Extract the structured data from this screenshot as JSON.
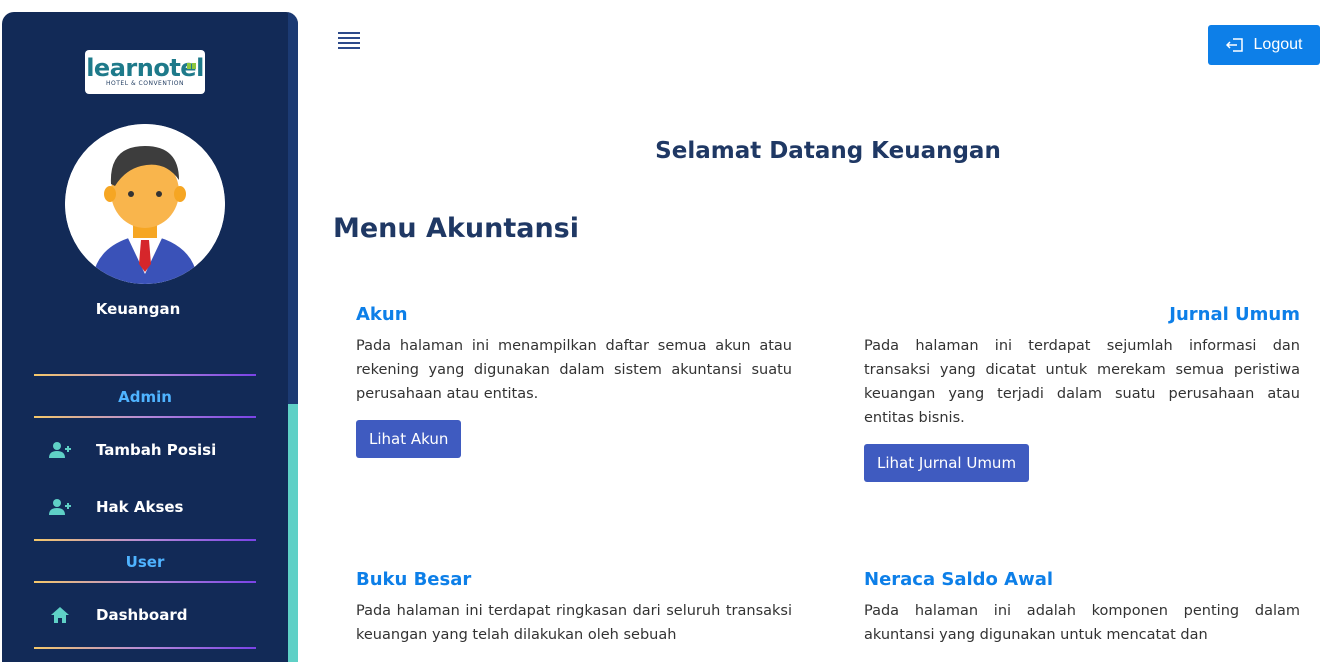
{
  "sidebar": {
    "logo": {
      "word": "learnotel",
      "subtitle": "HOTEL & CONVENTION"
    },
    "user_name": "Keuangan",
    "sections": [
      {
        "label": "Admin"
      },
      {
        "label": "User"
      }
    ],
    "items": [
      {
        "label": "Tambah Posisi",
        "icon": "user-plus-icon"
      },
      {
        "label": "Hak Akses",
        "icon": "user-plus-icon"
      },
      {
        "label": "Dashboard",
        "icon": "home-icon"
      }
    ]
  },
  "header": {
    "menu_icon": "hamburger-icon",
    "logout_label": "Logout"
  },
  "main": {
    "welcome": "Selamat Datang Keuangan",
    "title": "Menu Akuntansi",
    "cards": [
      {
        "title": "Akun",
        "desc": "Pada halaman ini menampilkan daftar semua akun atau rekening yang digunakan dalam sistem akuntansi suatu perusahaan atau entitas.",
        "button": "Lihat Akun"
      },
      {
        "title": "Jurnal Umum",
        "desc": "Pada halaman ini terdapat sejumlah informasi dan transaksi yang dicatat untuk merekam semua peristiwa keuangan yang terjadi dalam suatu perusahaan atau entitas bisnis.",
        "button": "Lihat Jurnal Umum"
      },
      {
        "title": "Buku Besar",
        "desc": "Pada halaman ini terdapat ringkasan dari seluruh transaksi keuangan yang telah dilakukan oleh sebuah"
      },
      {
        "title": "Neraca Saldo Awal",
        "desc": "Pada halaman ini adalah komponen penting dalam akuntansi yang digunakan untuk mencatat dan"
      }
    ]
  },
  "colors": {
    "sidebar_bg": "#122a57",
    "accent": "#0d7fe8",
    "button": "#3f5bc0",
    "section_label": "#4fb3ff"
  }
}
